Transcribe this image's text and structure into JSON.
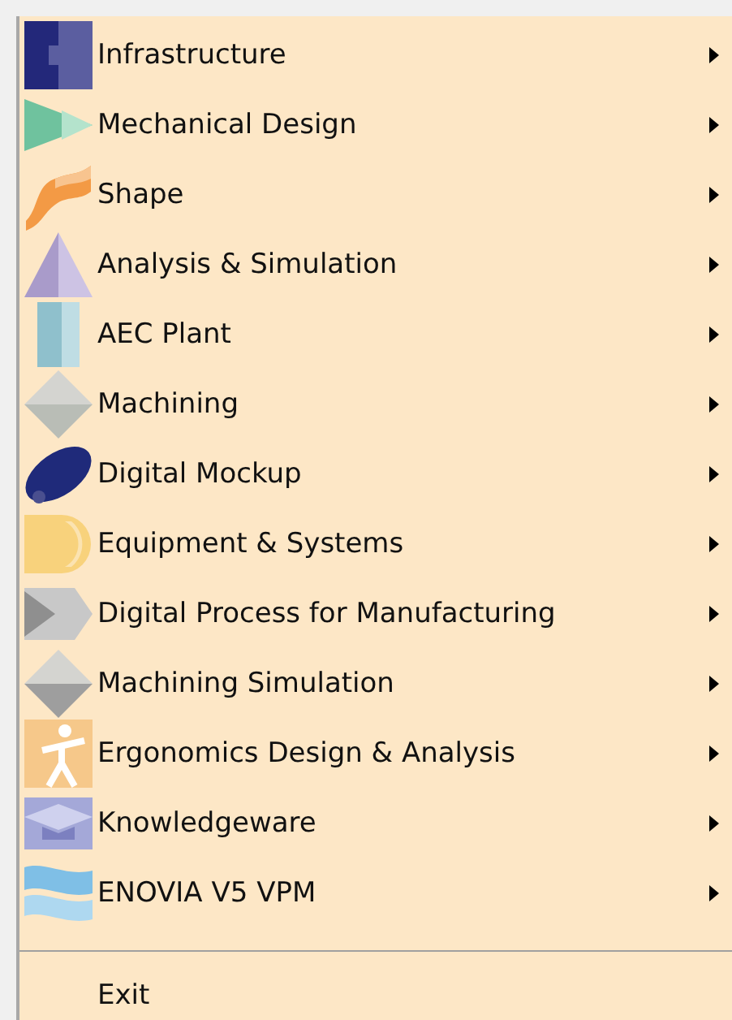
{
  "menu": {
    "items": [
      {
        "label": "Infrastructure",
        "kind": "infrastructure",
        "submenu": true
      },
      {
        "label": "Mechanical Design",
        "kind": "mechanical",
        "submenu": true
      },
      {
        "label": "Shape",
        "kind": "shape",
        "submenu": true
      },
      {
        "label": "Analysis & Simulation",
        "kind": "analysis",
        "submenu": true
      },
      {
        "label": "AEC Plant",
        "kind": "plant",
        "submenu": true
      },
      {
        "label": "Machining",
        "kind": "machining",
        "submenu": true
      },
      {
        "label": "Digital Mockup",
        "kind": "mockup",
        "submenu": true
      },
      {
        "label": "Equipment & Systems",
        "kind": "equipment",
        "submenu": true
      },
      {
        "label": "Digital Process for Manufacturing",
        "kind": "process",
        "submenu": true
      },
      {
        "label": "Machining Simulation",
        "kind": "simulation",
        "submenu": true
      },
      {
        "label": "Ergonomics Design & Analysis",
        "kind": "ergonomics",
        "submenu": true
      },
      {
        "label": "Knowledgeware",
        "kind": "knowledge",
        "submenu": true
      },
      {
        "label": "ENOVIA V5 VPM",
        "kind": "enovia",
        "submenu": true
      }
    ],
    "footer_items": [
      {
        "label": "Exit"
      }
    ]
  }
}
